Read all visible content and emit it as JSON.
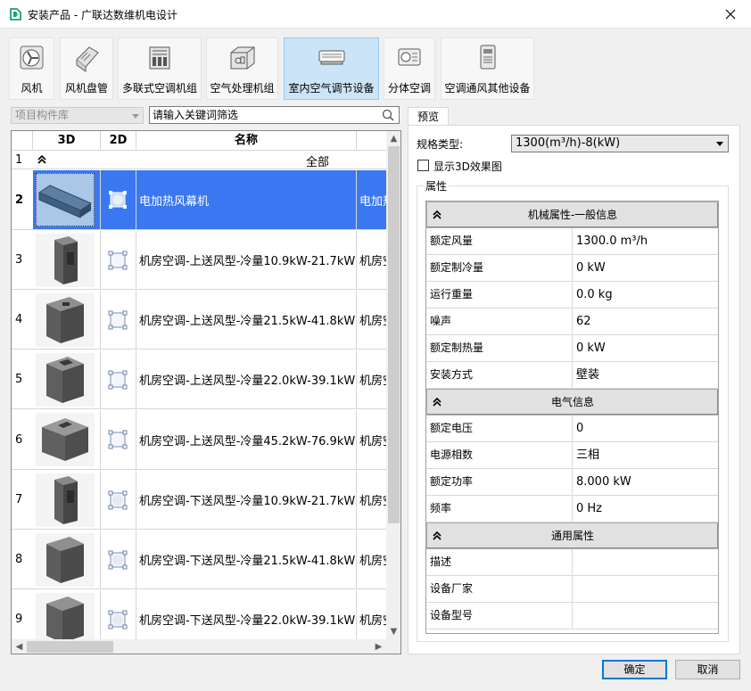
{
  "window": {
    "title": "安装产品 - 广联达数维机电设计"
  },
  "categories": [
    {
      "label": "风机",
      "icon": "fan-icon"
    },
    {
      "label": "风机盘管",
      "icon": "fan-coil-icon"
    },
    {
      "label": "多联式空调机组",
      "icon": "vrf-unit-icon"
    },
    {
      "label": "空气处理机组",
      "icon": "air-handling-unit-icon"
    },
    {
      "label": "室内空气调节设备",
      "icon": "indoor-ac-icon"
    },
    {
      "label": "分体空调",
      "icon": "split-ac-icon"
    },
    {
      "label": "空调通风其他设备",
      "icon": "other-hvac-icon"
    }
  ],
  "active_category": 4,
  "left": {
    "library_select": "项目构件库",
    "search_placeholder": "请输入关键词筛选",
    "columns": [
      "3D",
      "2D",
      "名称"
    ],
    "all_row": {
      "num": "1",
      "label": "全部"
    },
    "rows": [
      {
        "num": "2",
        "name": "电加热风幕机",
        "extra": "电加热",
        "selected": true
      },
      {
        "num": "3",
        "name": "机房空调-上送风型-冷量10.9kW-21.7kW",
        "extra": "机房空"
      },
      {
        "num": "4",
        "name": "机房空调-上送风型-冷量21.5kW-41.8kW",
        "extra": "机房空"
      },
      {
        "num": "5",
        "name": "机房空调-上送风型-冷量22.0kW-39.1kW",
        "extra": "机房空"
      },
      {
        "num": "6",
        "name": "机房空调-上送风型-冷量45.2kW-76.9kW",
        "extra": "机房空"
      },
      {
        "num": "7",
        "name": "机房空调-下送风型-冷量10.9kW-21.7kW",
        "extra": "机房空"
      },
      {
        "num": "8",
        "name": "机房空调-下送风型-冷量21.5kW-41.8kW",
        "extra": "机房空"
      },
      {
        "num": "9",
        "name": "机房空调-下送风型-冷量22.0kW-39.1kW",
        "extra": "机房空"
      }
    ]
  },
  "preview": {
    "tab": "预览",
    "spec_label": "规格类型:",
    "spec_value": "1300(m³/h)-8(kW)",
    "show3d_label": "显示3D效果图",
    "group_label": "属性",
    "sections": [
      {
        "title": "机械属性-一般信息",
        "rows": [
          {
            "key": "额定风量",
            "value": "1300.0 m³/h"
          },
          {
            "key": "额定制冷量",
            "value": "0 kW"
          },
          {
            "key": "运行重量",
            "value": "0.0 kg"
          },
          {
            "key": "噪声",
            "value": "62"
          },
          {
            "key": "额定制热量",
            "value": "0 kW"
          },
          {
            "key": "安装方式",
            "value": "壁装"
          }
        ]
      },
      {
        "title": "电气信息",
        "rows": [
          {
            "key": "额定电压",
            "value": "0"
          },
          {
            "key": "电源相数",
            "value": "三相"
          },
          {
            "key": "额定功率",
            "value": "8.000 kW"
          },
          {
            "key": "频率",
            "value": "0 Hz"
          }
        ]
      },
      {
        "title": "通用属性",
        "rows": [
          {
            "key": "描述",
            "value": ""
          },
          {
            "key": "设备厂家",
            "value": ""
          },
          {
            "key": "设备型号",
            "value": ""
          }
        ]
      }
    ]
  },
  "buttons": {
    "ok": "确定",
    "cancel": "取消"
  },
  "colors": {
    "selection": "#3a78f1",
    "active_tab": "#cce4f7",
    "primary_border": "#0078d7"
  }
}
